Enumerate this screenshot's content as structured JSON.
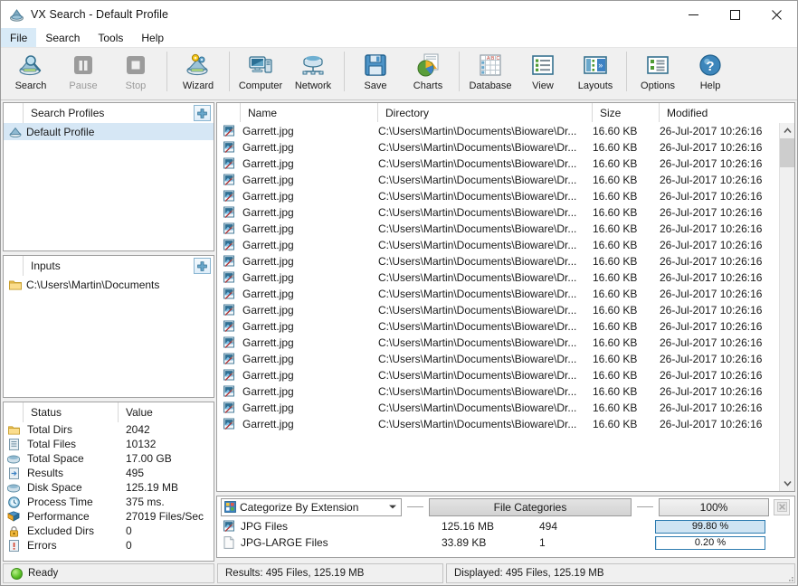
{
  "window": {
    "title": "VX Search - Default Profile",
    "icon": "app-icon",
    "minimize": "–",
    "maximize": "□",
    "close": "✕"
  },
  "menu": {
    "items": [
      {
        "label": "File",
        "active": true
      },
      {
        "label": "Search",
        "active": false
      },
      {
        "label": "Tools",
        "active": false
      },
      {
        "label": "Help",
        "active": false
      }
    ]
  },
  "toolbar": {
    "buttons": [
      {
        "label": "Search",
        "icon": "search-disk-icon",
        "disabled": false
      },
      {
        "label": "Pause",
        "icon": "pause-icon",
        "disabled": true
      },
      {
        "label": "Stop",
        "icon": "stop-icon",
        "disabled": true
      },
      {
        "label": "Wizard",
        "icon": "wizard-icon",
        "disabled": false
      },
      {
        "label": "Computer",
        "icon": "computer-icon",
        "disabled": false
      },
      {
        "label": "Network",
        "icon": "network-icon",
        "disabled": false
      },
      {
        "label": "Save",
        "icon": "save-floppy-icon",
        "disabled": false
      },
      {
        "label": "Charts",
        "icon": "charts-pie-icon",
        "disabled": false
      },
      {
        "label": "Database",
        "icon": "database-grid-icon",
        "disabled": false
      },
      {
        "label": "View",
        "icon": "view-list-icon",
        "disabled": false
      },
      {
        "label": "Layouts",
        "icon": "layouts-icon",
        "disabled": false
      },
      {
        "label": "Options",
        "icon": "options-icon",
        "disabled": false
      },
      {
        "label": "Help",
        "icon": "help-question-icon",
        "disabled": false
      }
    ]
  },
  "profiles_panel": {
    "title": "Search Profiles",
    "add_button": "add-profile-button",
    "items": [
      {
        "label": "Default Profile",
        "icon": "profile-icon",
        "selected": true
      }
    ]
  },
  "inputs_panel": {
    "title": "Inputs",
    "add_button": "add-input-button",
    "items": [
      {
        "label": "C:\\Users\\Martin\\Documents",
        "icon": "folder-icon",
        "selected": false
      }
    ]
  },
  "status_panel": {
    "headers": [
      "Status",
      "Value"
    ],
    "rows": [
      {
        "icon": "folder-icon",
        "label": "Total Dirs",
        "value": "2042"
      },
      {
        "icon": "file-icon",
        "label": "Total Files",
        "value": "10132"
      },
      {
        "icon": "disk-icon",
        "label": "Total Space",
        "value": "17.00 GB"
      },
      {
        "icon": "results-icon",
        "label": "Results",
        "value": "495"
      },
      {
        "icon": "disk-icon",
        "label": "Disk Space",
        "value": "125.19 MB"
      },
      {
        "icon": "clock-icon",
        "label": "Process Time",
        "value": "375 ms."
      },
      {
        "icon": "performance-icon",
        "label": "Performance",
        "value": "27019 Files/Sec"
      },
      {
        "icon": "lock-icon",
        "label": "Excluded Dirs",
        "value": "0"
      },
      {
        "icon": "error-icon",
        "label": "Errors",
        "value": "0"
      }
    ]
  },
  "file_list": {
    "headers": [
      "Name",
      "Directory",
      "Size",
      "Modified"
    ],
    "rows": [
      {
        "icon": "jpg-file-icon",
        "name": "Garrett.jpg",
        "directory": "C:\\Users\\Martin\\Documents\\Bioware\\Dr...",
        "size": "16.60 KB",
        "modified": "26-Jul-2017 10:26:16"
      },
      {
        "icon": "jpg-file-icon",
        "name": "Garrett.jpg",
        "directory": "C:\\Users\\Martin\\Documents\\Bioware\\Dr...",
        "size": "16.60 KB",
        "modified": "26-Jul-2017 10:26:16"
      },
      {
        "icon": "jpg-file-icon",
        "name": "Garrett.jpg",
        "directory": "C:\\Users\\Martin\\Documents\\Bioware\\Dr...",
        "size": "16.60 KB",
        "modified": "26-Jul-2017 10:26:16"
      },
      {
        "icon": "jpg-file-icon",
        "name": "Garrett.jpg",
        "directory": "C:\\Users\\Martin\\Documents\\Bioware\\Dr...",
        "size": "16.60 KB",
        "modified": "26-Jul-2017 10:26:16"
      },
      {
        "icon": "jpg-file-icon",
        "name": "Garrett.jpg",
        "directory": "C:\\Users\\Martin\\Documents\\Bioware\\Dr...",
        "size": "16.60 KB",
        "modified": "26-Jul-2017 10:26:16"
      },
      {
        "icon": "jpg-file-icon",
        "name": "Garrett.jpg",
        "directory": "C:\\Users\\Martin\\Documents\\Bioware\\Dr...",
        "size": "16.60 KB",
        "modified": "26-Jul-2017 10:26:16"
      },
      {
        "icon": "jpg-file-icon",
        "name": "Garrett.jpg",
        "directory": "C:\\Users\\Martin\\Documents\\Bioware\\Dr...",
        "size": "16.60 KB",
        "modified": "26-Jul-2017 10:26:16"
      },
      {
        "icon": "jpg-file-icon",
        "name": "Garrett.jpg",
        "directory": "C:\\Users\\Martin\\Documents\\Bioware\\Dr...",
        "size": "16.60 KB",
        "modified": "26-Jul-2017 10:26:16"
      },
      {
        "icon": "jpg-file-icon",
        "name": "Garrett.jpg",
        "directory": "C:\\Users\\Martin\\Documents\\Bioware\\Dr...",
        "size": "16.60 KB",
        "modified": "26-Jul-2017 10:26:16"
      },
      {
        "icon": "jpg-file-icon",
        "name": "Garrett.jpg",
        "directory": "C:\\Users\\Martin\\Documents\\Bioware\\Dr...",
        "size": "16.60 KB",
        "modified": "26-Jul-2017 10:26:16"
      },
      {
        "icon": "jpg-file-icon",
        "name": "Garrett.jpg",
        "directory": "C:\\Users\\Martin\\Documents\\Bioware\\Dr...",
        "size": "16.60 KB",
        "modified": "26-Jul-2017 10:26:16"
      },
      {
        "icon": "jpg-file-icon",
        "name": "Garrett.jpg",
        "directory": "C:\\Users\\Martin\\Documents\\Bioware\\Dr...",
        "size": "16.60 KB",
        "modified": "26-Jul-2017 10:26:16"
      },
      {
        "icon": "jpg-file-icon",
        "name": "Garrett.jpg",
        "directory": "C:\\Users\\Martin\\Documents\\Bioware\\Dr...",
        "size": "16.60 KB",
        "modified": "26-Jul-2017 10:26:16"
      },
      {
        "icon": "jpg-file-icon",
        "name": "Garrett.jpg",
        "directory": "C:\\Users\\Martin\\Documents\\Bioware\\Dr...",
        "size": "16.60 KB",
        "modified": "26-Jul-2017 10:26:16"
      },
      {
        "icon": "jpg-file-icon",
        "name": "Garrett.jpg",
        "directory": "C:\\Users\\Martin\\Documents\\Bioware\\Dr...",
        "size": "16.60 KB",
        "modified": "26-Jul-2017 10:26:16"
      },
      {
        "icon": "jpg-file-icon",
        "name": "Garrett.jpg",
        "directory": "C:\\Users\\Martin\\Documents\\Bioware\\Dr...",
        "size": "16.60 KB",
        "modified": "26-Jul-2017 10:26:16"
      },
      {
        "icon": "jpg-file-icon",
        "name": "Garrett.jpg",
        "directory": "C:\\Users\\Martin\\Documents\\Bioware\\Dr...",
        "size": "16.60 KB",
        "modified": "26-Jul-2017 10:26:16"
      },
      {
        "icon": "jpg-file-icon",
        "name": "Garrett.jpg",
        "directory": "C:\\Users\\Martin\\Documents\\Bioware\\Dr...",
        "size": "16.60 KB",
        "modified": "26-Jul-2017 10:26:16"
      },
      {
        "icon": "jpg-file-icon",
        "name": "Garrett.jpg",
        "directory": "C:\\Users\\Martin\\Documents\\Bioware\\Dr...",
        "size": "16.60 KB",
        "modified": "26-Jul-2017 10:26:16"
      }
    ]
  },
  "categories": {
    "mode_select": {
      "value": "Categorize By Extension",
      "icon": "categorize-icon",
      "arrow": "chevron-down-icon"
    },
    "tab_label": "File Categories",
    "zoom_label": "100%",
    "close_button": "close-chart-button",
    "rows": [
      {
        "icon": "jpg-file-icon",
        "name": "JPG Files",
        "size": "125.16 MB",
        "count": "494",
        "percent_label": "99.80 %",
        "percent": 99.8
      },
      {
        "icon": "blank-file-icon",
        "name": "JPG-LARGE Files",
        "size": "33.89 KB",
        "count": "1",
        "percent_label": "0.20 %",
        "percent": 0.2
      }
    ]
  },
  "statusbar": {
    "state": "Ready",
    "results": "Results: 495 Files, 125.19 MB",
    "displayed": "Displayed: 495 Files, 125.19 MB"
  },
  "colors": {
    "accent": "#2e7cb0",
    "selection": "#d6e7f5",
    "bar_fill": "#cfe4f3",
    "window_bg": "#f0f0f0"
  }
}
